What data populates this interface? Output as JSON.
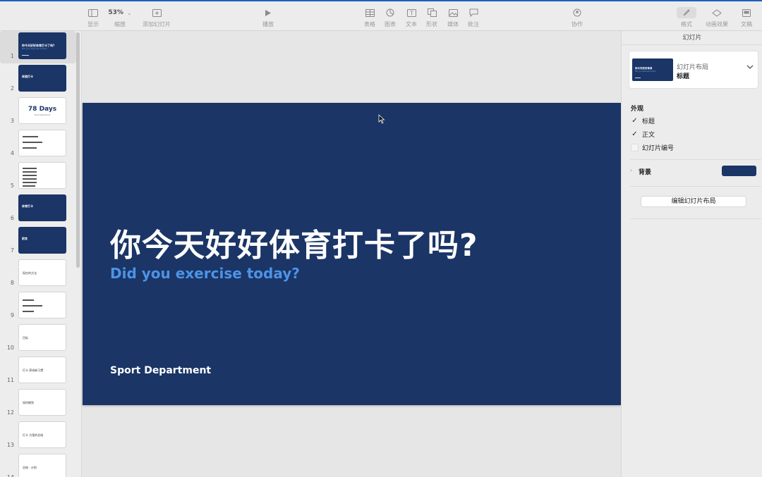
{
  "toolbar": {
    "view": "显示",
    "zoom_value": "53%",
    "zoom_label": "缩放",
    "add_slide": "添加幻灯片",
    "play": "播放",
    "table": "表格",
    "chart": "图表",
    "text": "文本",
    "shape": "形状",
    "media": "媒体",
    "comment": "批注",
    "collaborate": "协作",
    "format": "格式",
    "animate": "动画效果",
    "document": "文稿"
  },
  "navigator": {
    "slides": [
      {
        "num": "1",
        "title": "你今天好好体育打卡了吗?",
        "sub": "Did you exercise today?"
      },
      {
        "num": "2",
        "title": "体验打卡"
      },
      {
        "num": "3",
        "big": "78 Days",
        "sub": "Sport Department"
      },
      {
        "num": "4"
      },
      {
        "num": "5"
      },
      {
        "num": "6",
        "title": "体育打卡"
      },
      {
        "num": "7",
        "title": "前言"
      },
      {
        "num": "8",
        "text": "现在的方法"
      },
      {
        "num": "9"
      },
      {
        "num": "10",
        "text": "目标"
      },
      {
        "num": "11",
        "text": "打卡 养成新习惯"
      },
      {
        "num": "12",
        "text": "如何做到"
      },
      {
        "num": "13",
        "text": "打卡 方案的总结"
      },
      {
        "num": "14",
        "text": "总结 · 计划"
      }
    ]
  },
  "slide": {
    "title": "你今天好好体育打卡了吗?",
    "subtitle": "Did you exercise today?",
    "footer": "Sport Department"
  },
  "inspector": {
    "header": "幻灯片",
    "layout_label": "幻灯片布局",
    "layout_value": "标题",
    "layout_thumb_title": "你今天好好体育",
    "appearance": "外观",
    "checks": [
      {
        "label": "标题",
        "checked": true
      },
      {
        "label": "正文",
        "checked": true
      },
      {
        "label": "幻灯片编号",
        "checked": false
      }
    ],
    "background_label": "背景",
    "background_color": "#1a3566",
    "edit_layout": "编辑幻灯片布局"
  },
  "colors": {
    "slide_bg": "#1a3566",
    "subtitle": "#4d93e6"
  }
}
